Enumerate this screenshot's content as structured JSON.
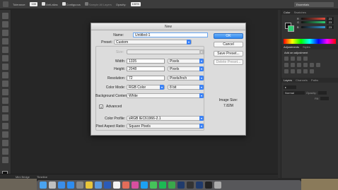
{
  "options_bar": {
    "tolerance_label": "Tolerance:",
    "tolerance_value": "100",
    "anti_alias_label": "Anti-alias",
    "contiguous_label": "Contiguous",
    "sample_all_label": "Sample All Layers",
    "opacity_label": "Opacity:",
    "opacity_value": "100%",
    "workspace": "Essentials"
  },
  "status_bar": {
    "tabs": [
      "Mini Bridge",
      "Timeline"
    ]
  },
  "panels": {
    "color_tabs": [
      "Color",
      "Swatches"
    ],
    "color_channels": [
      {
        "label": "R",
        "value": "23",
        "track": "#e74c3c"
      },
      {
        "label": "G",
        "value": "23",
        "track": "#2ecc71"
      },
      {
        "label": "B",
        "value": "23",
        "track": "#3498db"
      }
    ],
    "adjust_tabs": [
      "Adjustments",
      "Styles"
    ],
    "adjust_title": "Add an adjustment",
    "layers_tabs": [
      "Layers",
      "Channels",
      "Paths"
    ],
    "layers_kind": "Normal",
    "layers_opacity_label": "Opacity:",
    "layers_fill_label": "Fill:"
  },
  "dialog": {
    "title": "New",
    "name_label": "Name:",
    "name_value": "Untitled-1",
    "preset_label": "Preset:",
    "preset_value": "Custom",
    "size_label": "Size:",
    "width_label": "Width:",
    "width_value": "1335",
    "width_unit": "Pixels",
    "height_label": "Height:",
    "height_value": "2048",
    "height_unit": "Pixels",
    "resolution_label": "Resolution:",
    "resolution_value": "72",
    "resolution_unit": "Pixels/Inch",
    "color_mode_label": "Color Mode:",
    "color_mode_value": "RGB Color",
    "bit_depth_value": "8 bit",
    "bg_contents_label": "Background Contents:",
    "bg_contents_value": "White",
    "advanced_label": "Advanced",
    "color_profile_label": "Color Profile:",
    "color_profile_value": "sRGB IEC61966-2.1",
    "pixel_aspect_label": "Pixel Aspect Ratio:",
    "pixel_aspect_value": "Square Pixels",
    "ok_label": "OK",
    "cancel_label": "Cancel",
    "save_preset_label": "Save Preset...",
    "delete_preset_label": "Delete Preset...",
    "image_size_label": "Image Size:",
    "image_size_value": "7.82M"
  },
  "dock_icons": [
    {
      "name": "finder-icon",
      "color": "#4aa3f0"
    },
    {
      "name": "launchpad-icon",
      "color": "#c0c0c0"
    },
    {
      "name": "safari-icon",
      "color": "#3b8ee8"
    },
    {
      "name": "app-store-icon",
      "color": "#2d8cf0"
    },
    {
      "name": "rocket-icon",
      "color": "#888"
    },
    {
      "name": "chrome-icon",
      "color": "#e8c53a"
    },
    {
      "name": "mail-icon",
      "color": "#5b9be0"
    },
    {
      "name": "word-icon",
      "color": "#2b5bb8"
    },
    {
      "name": "calendar-icon",
      "color": "#f3f3f3"
    },
    {
      "name": "photos-icon",
      "color": "#e26d5a"
    },
    {
      "name": "itunes-icon",
      "color": "#d94fa0"
    },
    {
      "name": "twitter-icon",
      "color": "#1da1f2"
    },
    {
      "name": "messages-icon",
      "color": "#45c25a"
    },
    {
      "name": "spotify-icon",
      "color": "#1db954"
    },
    {
      "name": "facetime-icon",
      "color": "#3aa84b"
    },
    {
      "name": "photoshop-icon",
      "color": "#1f3a6b"
    },
    {
      "name": "bridge-icon",
      "color": "#333"
    },
    {
      "name": "photoshop-icon-2",
      "color": "#1f3a6b"
    },
    {
      "name": "terminal-icon",
      "color": "#222"
    },
    {
      "name": "trash-icon",
      "color": "#aaa"
    }
  ]
}
